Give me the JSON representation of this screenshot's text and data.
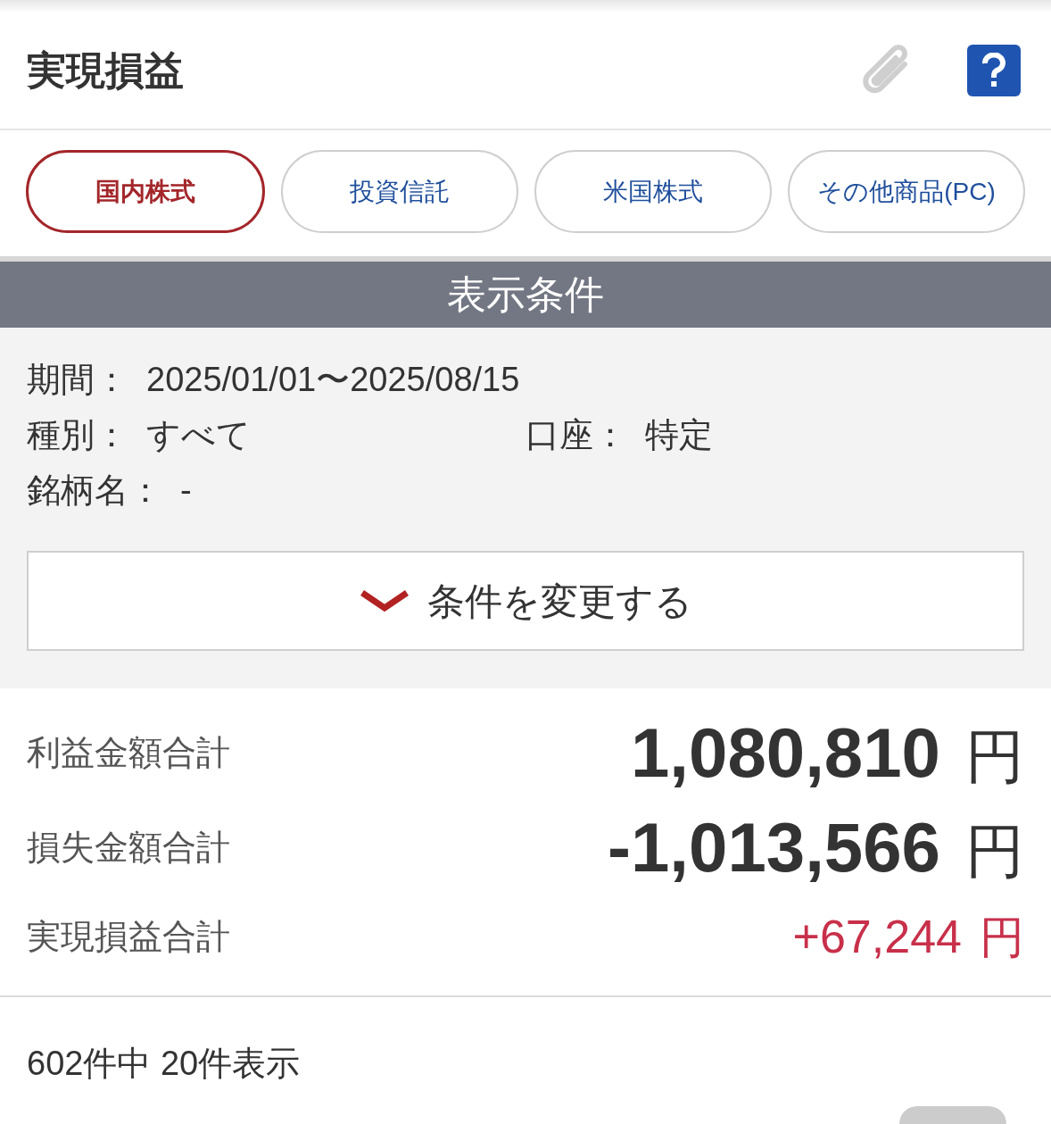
{
  "header": {
    "title": "実現損益"
  },
  "tabs": [
    {
      "label": "国内株式",
      "selected": true
    },
    {
      "label": "投資信託",
      "selected": false
    },
    {
      "label": "米国株式",
      "selected": false
    },
    {
      "label": "その他商品(PC)",
      "selected": false
    }
  ],
  "conditions": {
    "title": "表示条件",
    "lines": [
      [
        {
          "label": "期間：",
          "value": "2025/01/01〜2025/08/15"
        }
      ],
      [
        {
          "label": "種別：",
          "value": "すべて"
        },
        {
          "label": "口座：",
          "value": "特定"
        }
      ],
      [
        {
          "label": "銘柄名：",
          "value": "-"
        }
      ]
    ],
    "change_button": "条件を変更する"
  },
  "totals": [
    {
      "kind": "major",
      "label": "利益金額合計",
      "value": "1,080,810",
      "unit": "円"
    },
    {
      "kind": "major",
      "label": "損失金額合計",
      "value": "-1,013,566",
      "unit": "円"
    },
    {
      "kind": "net",
      "label": "実現損益合計",
      "value": "+67,244",
      "unit": "円"
    }
  ],
  "count": "602件中 20件表示"
}
